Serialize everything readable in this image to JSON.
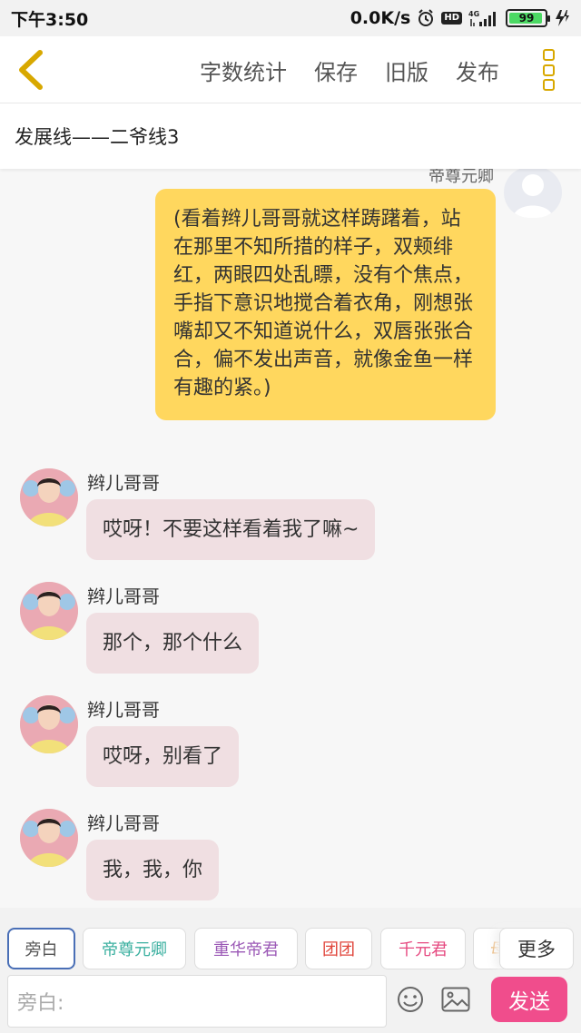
{
  "status_bar": {
    "time": "下午3:50",
    "network_speed": "0.0K/s",
    "hd_label": "HD",
    "network_type": "4G",
    "battery_level": "99"
  },
  "nav": {
    "actions": [
      "字数统计",
      "保存",
      "旧版",
      "发布"
    ]
  },
  "title": "发展线——二爷线3",
  "chat": {
    "right_message": {
      "sender": "帝尊元卿",
      "text": "(看着辫儿哥哥就这样踌躇着，站在那里不知所措的样子，双颊绯红，两眼四处乱瞟，没有个焦点，手指下意识地搅合着衣角，刚想张嘴却又不知道说什么，双唇张张合合，偏不发出声音，就像金鱼一样有趣的紧。)"
    },
    "left_messages": [
      {
        "sender": "辫儿哥哥",
        "text": "哎呀！不要这样看着我了嘛~"
      },
      {
        "sender": "辫儿哥哥",
        "text": "那个，那个什么"
      },
      {
        "sender": "辫儿哥哥",
        "text": "哎呀，别看了"
      },
      {
        "sender": "辫儿哥哥",
        "text": "我，我，你"
      }
    ]
  },
  "roles": {
    "items": [
      {
        "label": "旁白",
        "color": "#555555"
      },
      {
        "label": "帝尊元卿",
        "color": "#3bb0a0"
      },
      {
        "label": "重华帝君",
        "color": "#9b59b6"
      },
      {
        "label": "团团",
        "color": "#e0463c"
      },
      {
        "label": "千元君",
        "color": "#e64980"
      },
      {
        "label": "母",
        "color": "#e8a04b"
      }
    ],
    "more_label": "更多"
  },
  "input": {
    "placeholder": "旁白:",
    "send_label": "发送"
  },
  "colors": {
    "accent_yellow": "#ffd75e",
    "left_bubble": "#f0dfe2",
    "send_button": "#f04d8c"
  }
}
